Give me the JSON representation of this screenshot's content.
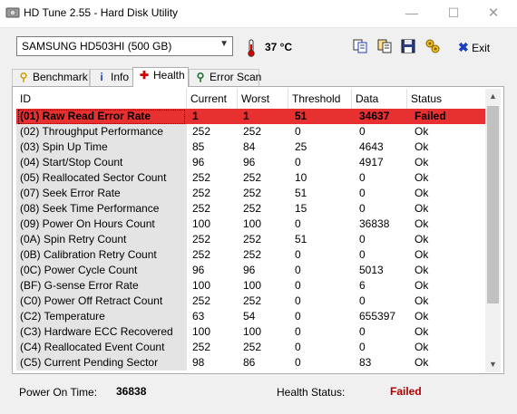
{
  "window": {
    "title": "HD Tune 2.55 - Hard Disk Utility",
    "min": "—",
    "max": "☐",
    "close": "✕"
  },
  "toolbar": {
    "drive": "SAMSUNG HD503HI (500 GB)",
    "temperature": "37 °C",
    "exit_label": "Exit",
    "icons": [
      "copy-icon",
      "copy-all-icon",
      "save-icon",
      "options-icon"
    ]
  },
  "tabs": [
    {
      "label": "Benchmark",
      "icon": "benchmark-icon"
    },
    {
      "label": "Info",
      "icon": "info-icon"
    },
    {
      "label": "Health",
      "icon": "health-cross-icon"
    },
    {
      "label": "Error Scan",
      "icon": "magnifier-icon"
    }
  ],
  "columns": [
    "ID",
    "Current",
    "Worst",
    "Threshold",
    "Data",
    "Status"
  ],
  "rows": [
    [
      "(01) Raw Read Error Rate",
      "1",
      "1",
      "51",
      "34637",
      "Failed"
    ],
    [
      "(02) Throughput Performance",
      "252",
      "252",
      "0",
      "0",
      "Ok"
    ],
    [
      "(03) Spin Up Time",
      "85",
      "84",
      "25",
      "4643",
      "Ok"
    ],
    [
      "(04) Start/Stop Count",
      "96",
      "96",
      "0",
      "4917",
      "Ok"
    ],
    [
      "(05) Reallocated Sector Count",
      "252",
      "252",
      "10",
      "0",
      "Ok"
    ],
    [
      "(07) Seek Error Rate",
      "252",
      "252",
      "51",
      "0",
      "Ok"
    ],
    [
      "(08) Seek Time Performance",
      "252",
      "252",
      "15",
      "0",
      "Ok"
    ],
    [
      "(09) Power On Hours Count",
      "100",
      "100",
      "0",
      "36838",
      "Ok"
    ],
    [
      "(0A) Spin Retry Count",
      "252",
      "252",
      "51",
      "0",
      "Ok"
    ],
    [
      "(0B) Calibration Retry Count",
      "252",
      "252",
      "0",
      "0",
      "Ok"
    ],
    [
      "(0C) Power Cycle Count",
      "96",
      "96",
      "0",
      "5013",
      "Ok"
    ],
    [
      "(BF) G-sense Error Rate",
      "100",
      "100",
      "0",
      "6",
      "Ok"
    ],
    [
      "(C0) Power Off Retract Count",
      "252",
      "252",
      "0",
      "0",
      "Ok"
    ],
    [
      "(C2) Temperature",
      "63",
      "54",
      "0",
      "655397",
      "Ok"
    ],
    [
      "(C3) Hardware ECC Recovered",
      "100",
      "100",
      "0",
      "0",
      "Ok"
    ],
    [
      "(C4) Reallocated Event Count",
      "252",
      "252",
      "0",
      "0",
      "Ok"
    ],
    [
      "(C5) Current Pending Sector",
      "98",
      "86",
      "0",
      "83",
      "Ok"
    ]
  ],
  "status": {
    "power_on_label": "Power On Time:",
    "power_on_value": "36838",
    "health_label": "Health Status:",
    "health_value": "Failed"
  },
  "colors": {
    "failed_row": "#e73030",
    "failed_text": "#b00000",
    "id_column_bg": "#e4e4e4"
  }
}
